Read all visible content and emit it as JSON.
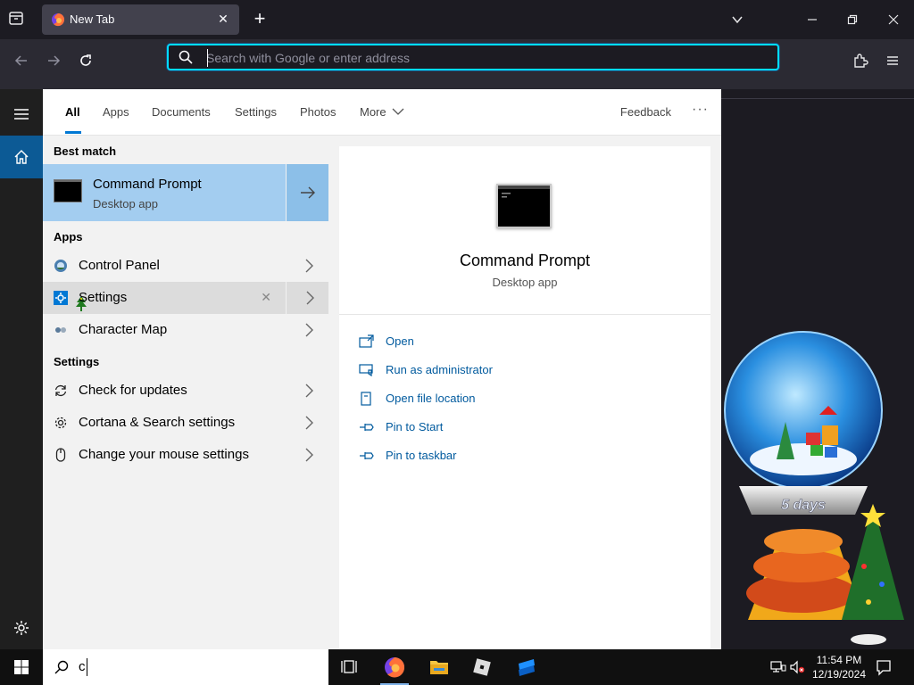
{
  "browser": {
    "tab_title": "New Tab",
    "url_placeholder": "Search with Google or enter address"
  },
  "search": {
    "filters": [
      "All",
      "Apps",
      "Documents",
      "Settings",
      "Photos",
      "More"
    ],
    "feedback": "Feedback",
    "dots": "···",
    "best_match_label": "Best match",
    "best_match": {
      "name": "Command Prompt",
      "type": "Desktop app"
    },
    "apps_label": "Apps",
    "apps": [
      "Control Panel",
      "Settings",
      "Character Map"
    ],
    "settings_label": "Settings",
    "settings": [
      "Check for updates",
      "Cortana & Search settings",
      "Change your mouse settings"
    ],
    "detail": {
      "name": "Command Prompt",
      "type": "Desktop app",
      "actions": [
        "Open",
        "Run as administrator",
        "Open file location",
        "Pin to Start",
        "Pin to taskbar"
      ]
    },
    "query": "c"
  },
  "widget": {
    "countdown": "5 days"
  },
  "taskbar": {
    "time": "11:54 PM",
    "date": "12/19/2024"
  },
  "colors": {
    "accent": "#0078d4",
    "best_match_bg": "#a3cdf0",
    "link": "#005a9e",
    "urlbar_focus": "#00ddff"
  }
}
